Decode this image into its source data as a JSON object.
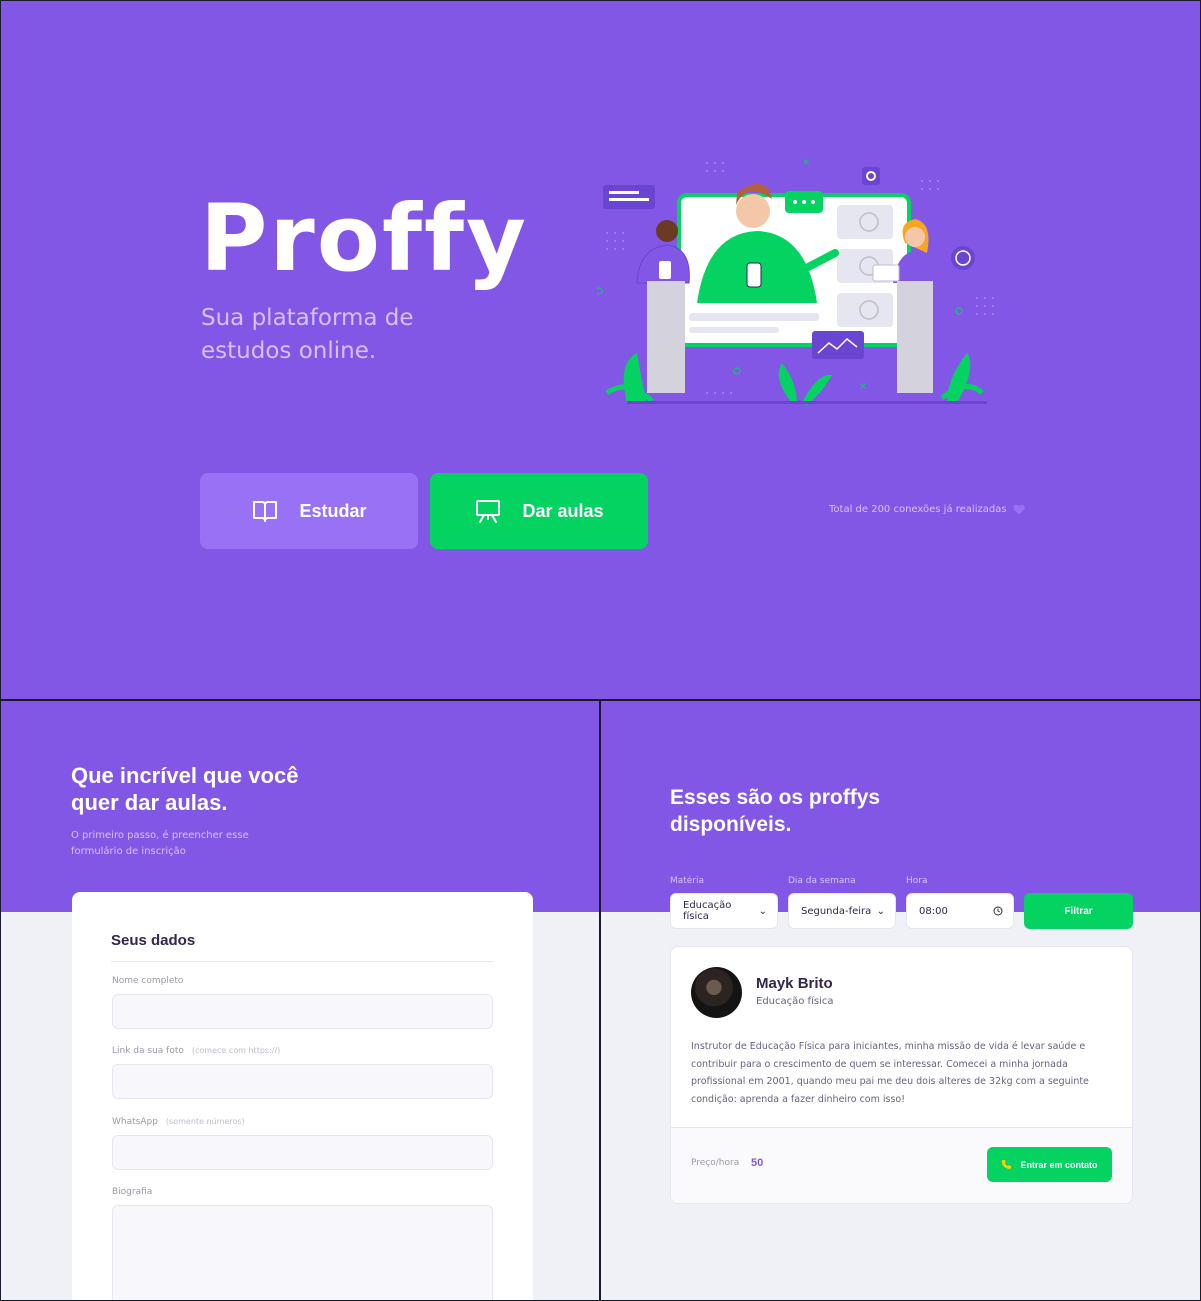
{
  "landing": {
    "logo": "Proffy",
    "tagline": "Sua plataforma de estudos online.",
    "study_button": "Estudar",
    "teach_button": "Dar aulas",
    "connections": "Total de 200 conexões já realizadas"
  },
  "teacher_form": {
    "title": "Que incrível que você quer dar aulas.",
    "subtitle": "O primeiro passo, é preencher esse formulário de inscrição",
    "section_title": "Seus dados",
    "fields": [
      {
        "label": "Nome completo",
        "hint": ""
      },
      {
        "label": "Link da sua foto",
        "hint": "(comece com https://)"
      },
      {
        "label": "WhatsApp",
        "hint": "(somente números)"
      },
      {
        "label": "Biografia",
        "hint": ""
      }
    ]
  },
  "teacher_list": {
    "title": "Esses são os proffys disponíveis.",
    "filters": {
      "subject_label": "Matéria",
      "subject_value": "Educação física",
      "weekday_label": "Dia da semana",
      "weekday_value": "Segunda-feira",
      "time_label": "Hora",
      "time_value": "08:00",
      "button": "Filtrar"
    },
    "card": {
      "name": "Mayk Brito",
      "subject": "Educação física",
      "bio": "Instrutor de Educação Física para iniciantes, minha missão de vida é levar saúde e contribuir para o crescimento de quem se interessar. Comecei a minha jornada profissional em 2001, quando meu pai me deu dois alteres de 32kg com a seguinte condição: aprenda a fazer dinheiro com isso!",
      "price_label": "Preço/hora",
      "price_value": "50",
      "contact_button": "Entrar em contato"
    }
  },
  "colors": {
    "primary": "#8257e5",
    "primary_light": "#9871f5",
    "secondary": "#04d361",
    "background": "#f0f0f7",
    "title": "#32264d"
  }
}
